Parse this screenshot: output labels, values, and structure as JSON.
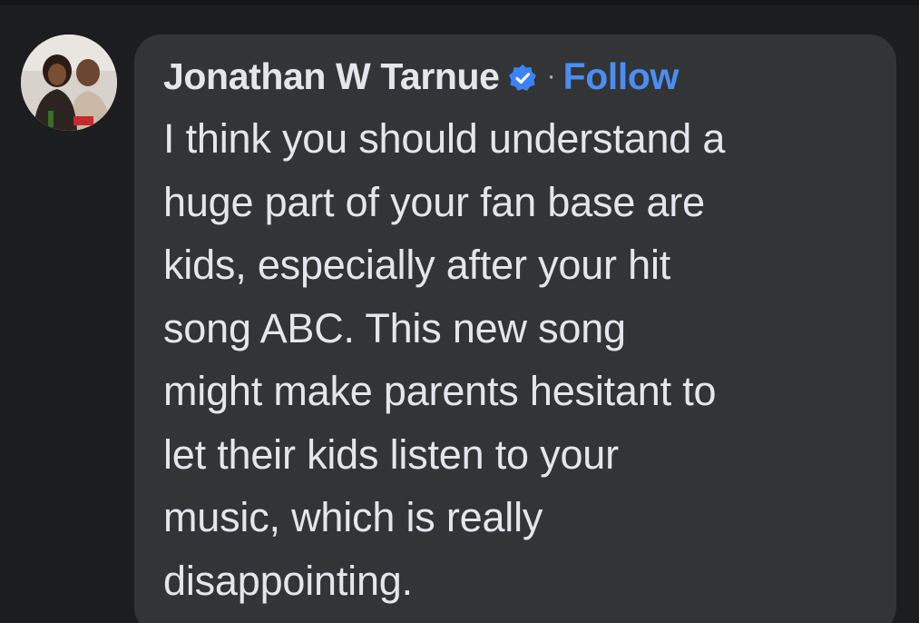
{
  "comment": {
    "author": "Jonathan W Tarnue",
    "verified_icon": "verified-badge-icon",
    "separator": "·",
    "follow_label": "Follow",
    "text_lines": [
      "I think you should understand a",
      "huge part of your fan base are",
      "kids, especially after your hit",
      "song ABC. This new song",
      "might make parents hesitant to",
      "let their kids listen to your",
      "music, which is really",
      "disappointing."
    ]
  },
  "colors": {
    "background": "#1c1d1f",
    "bubble": "#333436",
    "text": "#e4e6eb",
    "link": "#4a8ef5",
    "verified_badge": "#3b82f6"
  }
}
